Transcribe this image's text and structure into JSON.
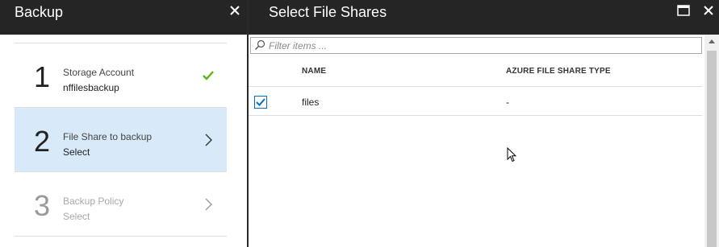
{
  "left_blade": {
    "title": "Backup",
    "steps": [
      {
        "number": "1",
        "title": "Storage Account",
        "subtitle": "nffilesbackup",
        "status": "complete"
      },
      {
        "number": "2",
        "title": "File Share to backup",
        "subtitle": "Select",
        "status": "active"
      },
      {
        "number": "3",
        "title": "Backup Policy",
        "subtitle": "Select",
        "status": "disabled"
      }
    ]
  },
  "right_blade": {
    "title": "Select File Shares",
    "filter": {
      "placeholder": "Filter items ...",
      "value": ""
    },
    "columns": [
      "NAME",
      "AZURE FILE SHARE TYPE"
    ],
    "rows": [
      {
        "name": "files",
        "type": "-",
        "selected": true
      }
    ]
  },
  "colors": {
    "header_bg": "#252526",
    "active_step_bg": "#d8e9f9",
    "check_green": "#5bb318",
    "checkbox_blue": "#0072c6"
  },
  "icons": {
    "close": "close-icon",
    "maximize": "maximize-icon",
    "check": "check-icon",
    "chevron": "chevron-right-icon",
    "filter": "search-icon",
    "cursor": "mouse-pointer-icon"
  }
}
